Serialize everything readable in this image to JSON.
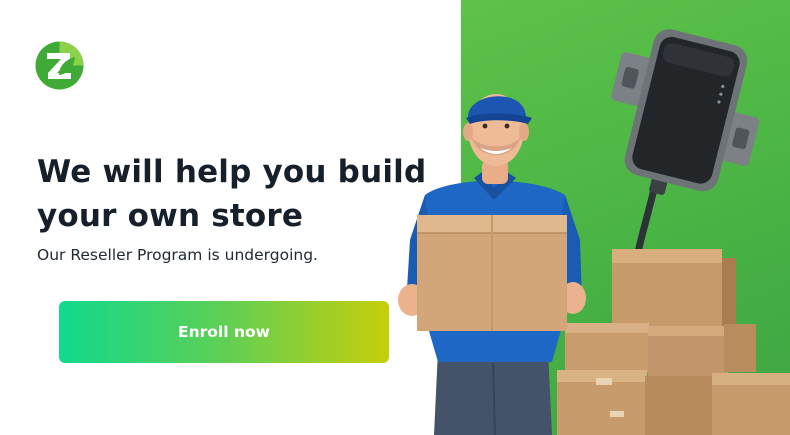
{
  "hero": {
    "headline_line1": "We will help you build",
    "headline_line2": "your own store",
    "subtitle": "Our Reseller Program is undergoing."
  },
  "cta": {
    "enroll_label": "Enroll now"
  },
  "colors": {
    "panel_green": "#4fb947",
    "button_gradient_start": "#10d98c",
    "button_gradient_end": "#c5cf0a",
    "headline_text": "#16202b",
    "logo_green": "#3faa35"
  },
  "icons": {
    "logo": "brand-logo-z-leaf-icon"
  }
}
